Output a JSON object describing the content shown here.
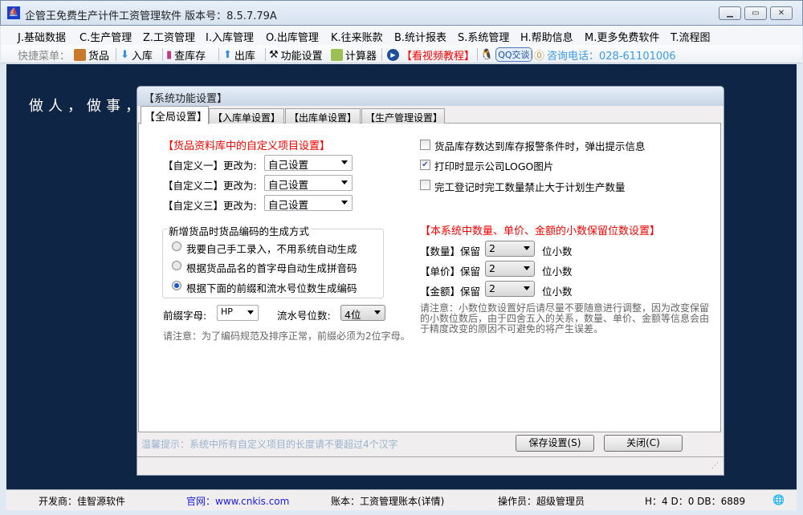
{
  "window": {
    "title": "企管王免费生产计件工资管理软件 版本号：8.5.7.79A",
    "app_icon": "sail-logo-icon",
    "minimize": "minimize-icon",
    "maximize": "maximize-icon",
    "close": "close-icon"
  },
  "menu": [
    "J.基础数据",
    "C.生产管理",
    "Z.工资管理",
    "I.入库管理",
    "O.出库管理",
    "K.往来账款",
    "B.统计报表",
    "S.系统管理",
    "H.帮助信息",
    "M.更多免费软件",
    "T.流程图"
  ],
  "toolbar": {
    "label": "快捷菜单：",
    "items": [
      "货品",
      "入库",
      "查库存",
      "出库",
      "功能设置",
      "计算器"
    ],
    "video": "【看视频教程】",
    "qq": "QQ交谈",
    "phone": "咨询电话：028-61101006",
    "colors": {
      "video": "#ff0000",
      "phone": "#3d9be9"
    }
  },
  "desktop": {
    "motto": "做人，做事，"
  },
  "dialog": {
    "title": "【系统功能设置】",
    "tabs": [
      "【全局设置】",
      "【入库单设置】",
      "【出库单设置】",
      "【生产管理设置】"
    ],
    "custom": {
      "header": "【货品资料库中的自定义项目设置】",
      "rows": [
        {
          "label": "【自定义一】更改为:",
          "value": "自己设置"
        },
        {
          "label": "【自定义二】更改为:",
          "value": "自己设置"
        },
        {
          "label": "【自定义三】更改为:",
          "value": "自己设置"
        }
      ]
    },
    "code_group": {
      "title": "新增货品时货品编码的生成方式",
      "options": [
        {
          "label": "我要自己手工录入，不用系统自动生成",
          "selected": false
        },
        {
          "label": "根据货品品名的首字母自动生成拼音码",
          "selected": false
        },
        {
          "label": "根据下面的前缀和流水号位数生成编码",
          "selected": true
        }
      ]
    },
    "prefix": {
      "label": "前缀字母:",
      "value": "HP"
    },
    "serial": {
      "label": "流水号位数:",
      "value": "4位"
    },
    "prefix_note": "请注意：为了编码规范及排序正常，前缀必须为2位字母。",
    "checks": [
      {
        "label": "货品库存数达到库存报警条件时，弹出提示信息",
        "checked": false
      },
      {
        "label": "打印时显示公司LOGO图片",
        "checked": true
      },
      {
        "label": "完工登记时完工数量禁止大于计划生产数量",
        "checked": false
      }
    ],
    "decimal": {
      "header": "【本系统中数量、单价、金额的小数保留位数设置】",
      "rows": [
        {
          "label": "【数量】保留",
          "value": "2",
          "unit": "位小数"
        },
        {
          "label": "【单价】保留",
          "value": "2",
          "unit": "位小数"
        },
        {
          "label": "【金额】保留",
          "value": "2",
          "unit": "位小数"
        }
      ],
      "note": "请注意：小数位数设置好后请尽量不要随意进行调整，因为改变保留的小数位数后，由于四舍五入的关系，数量、单价、金额等信息会由于精度改变的原因不可避免的将产生误差。"
    },
    "hint": "温馨提示：系统中所有自定义项目的长度请不要超过4个汉字",
    "save": "保存设置(S)",
    "close": "关闭(C)"
  },
  "status": {
    "developer": "开发商：佳智源软件",
    "website": "官网：www.cnkis.com",
    "account": "账本：工资管理账本(详情)",
    "operator": "操作员：超级管理员",
    "db": "H：4 D：0 DB：6889"
  }
}
